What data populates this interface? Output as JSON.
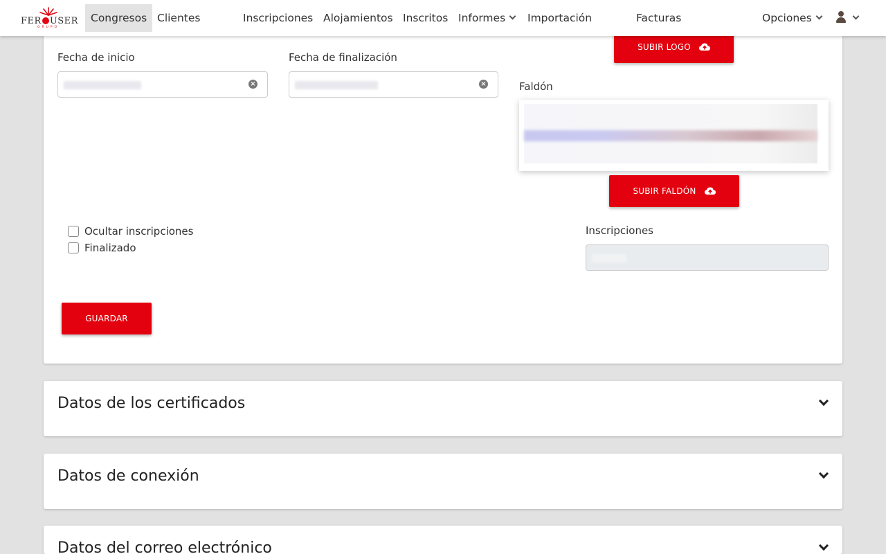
{
  "brand": {
    "logo_text_left": "FER",
    "logo_text_right": "USER",
    "logo_sub": "GRUPO",
    "accent": "#e3000f"
  },
  "nav": {
    "items": [
      {
        "label": "Congresos",
        "active": true
      },
      {
        "label": "Clientes"
      },
      {
        "label": "Inscripciones"
      },
      {
        "label": "Alojamientos"
      },
      {
        "label": "Inscritos"
      },
      {
        "label": "Informes",
        "dropdown": true
      },
      {
        "label": "Importación"
      },
      {
        "label": "Facturas"
      }
    ],
    "options_label": "Opciones",
    "user_icon": "user-icon"
  },
  "form": {
    "fecha_inicio_label": "Fecha de inicio",
    "fecha_fin_label": "Fecha de finalización",
    "subir_logo": "SUBIR LOGO",
    "faldon_label": "Faldón",
    "subir_faldon": "SUBIR FALDÓN",
    "ocultar_inscripciones": "Ocultar inscripciones",
    "finalizado": "Finalizado",
    "inscripciones_label": "Inscripciones",
    "guardar": "GUARDAR"
  },
  "sections": [
    {
      "title": "Datos de los certificados"
    },
    {
      "title": "Datos de conexión"
    },
    {
      "title": "Datos del correo electrónico"
    }
  ]
}
